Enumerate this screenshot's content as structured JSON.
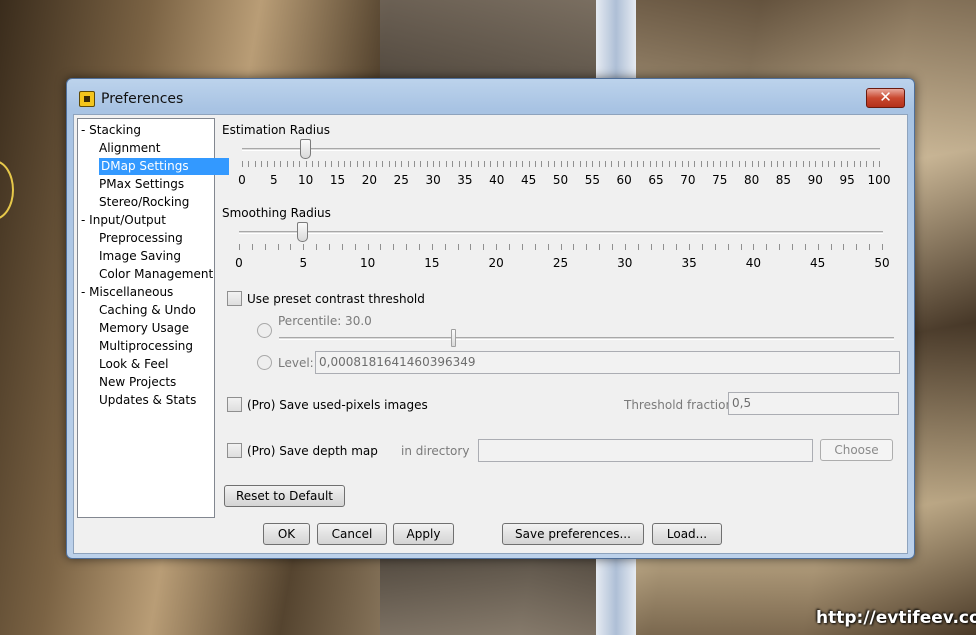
{
  "window": {
    "title": "Preferences"
  },
  "nav": {
    "groups": [
      {
        "label": "Stacking",
        "items": [
          "Alignment",
          "DMap Settings",
          "PMax Settings",
          "Stereo/Rocking"
        ]
      },
      {
        "label": "Input/Output",
        "items": [
          "Preprocessing",
          "Image Saving",
          "Color Management"
        ]
      },
      {
        "label": "Miscellaneous",
        "items": [
          "Caching & Undo",
          "Memory Usage",
          "Multiprocessing",
          "Look & Feel",
          "New Projects",
          "Updates & Stats"
        ]
      }
    ],
    "group_prefix": "-",
    "selected": "DMap Settings"
  },
  "estimation": {
    "label": "Estimation Radius",
    "min": 0,
    "max": 100,
    "value": 10,
    "ticks": [
      "0",
      "5",
      "10",
      "15",
      "20",
      "25",
      "30",
      "35",
      "40",
      "45",
      "50",
      "55",
      "60",
      "65",
      "70",
      "75",
      "80",
      "85",
      "90",
      "95",
      "100"
    ]
  },
  "smoothing": {
    "label": "Smoothing Radius",
    "min": 0,
    "max": 50,
    "value": 5,
    "ticks": [
      "0",
      "5",
      "10",
      "15",
      "20",
      "25",
      "30",
      "35",
      "40",
      "45",
      "50"
    ]
  },
  "contrast": {
    "checkbox_label": "Use preset contrast threshold",
    "percentile_label": "Percentile: 30.0",
    "percentile_value": 30.0,
    "level_label": "Level:",
    "level_value": "0,0008181641460396349"
  },
  "used_pixels": {
    "checkbox_label": "(Pro) Save used-pixels images",
    "threshold_label": "Threshold fraction",
    "threshold_value": "0,5"
  },
  "depth_map": {
    "checkbox_label": "(Pro) Save depth map",
    "directory_label": "in directory",
    "directory_value": "",
    "choose_label": "Choose"
  },
  "buttons": {
    "reset": "Reset to Default",
    "ok": "OK",
    "cancel": "Cancel",
    "apply": "Apply",
    "save": "Save preferences...",
    "load": "Load..."
  },
  "watermark": "http://evtifeev.com"
}
